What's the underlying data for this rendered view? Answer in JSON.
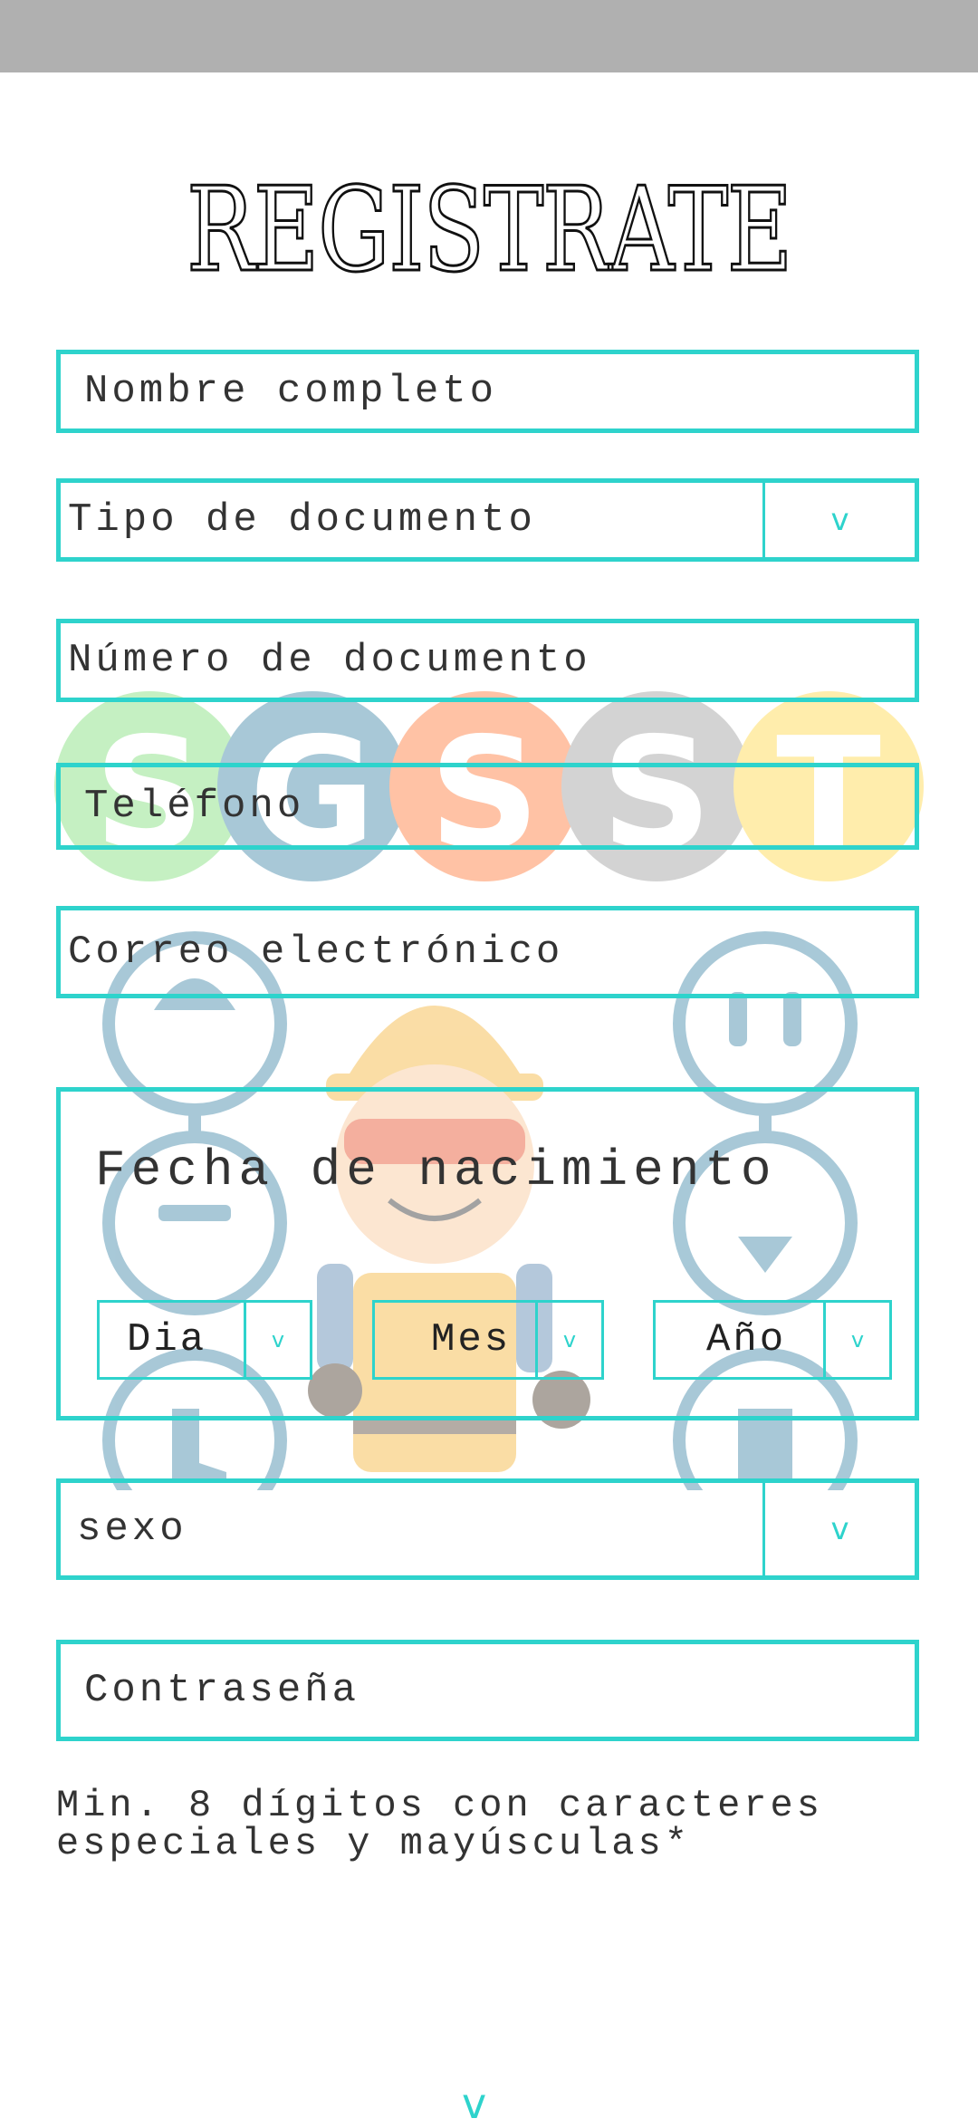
{
  "page": {
    "title": "REGISTRATE"
  },
  "form": {
    "full_name_placeholder": "Nombre completo",
    "doc_type_placeholder": "Tipo de documento",
    "doc_number_placeholder": "Número de documento",
    "phone_placeholder": "Teléfono",
    "email_placeholder": "Correo electrónico",
    "dob": {
      "label": "Fecha de nacimiento",
      "day": "Dia",
      "month": "Mes",
      "year": "Año"
    },
    "sex_placeholder": "sexo",
    "password_placeholder": "Contraseña",
    "password_hint": "Min. 8 dígitos con caracteres especiales y mayúsculas*"
  },
  "icons": {
    "dropdown": "chevron-down-icon",
    "scroll": "chevron-down-icon"
  },
  "background": {
    "logo_letters": [
      "S",
      "G",
      "S",
      "S",
      "T"
    ]
  },
  "colors": {
    "accent": "#2ed3cc",
    "status_bar": "#b0b0b0"
  }
}
